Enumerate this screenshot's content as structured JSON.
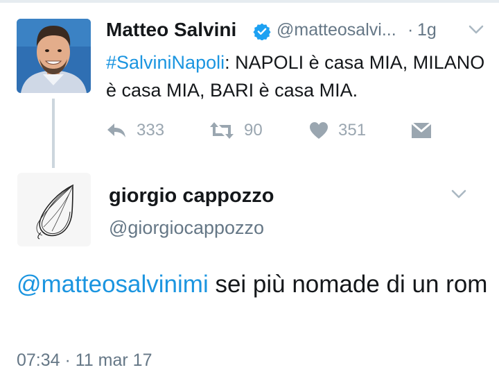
{
  "tweet": {
    "author_name": "Matteo Salvini",
    "author_handle": "@matteosalvi...",
    "separator": "·",
    "time": "1g",
    "hashtag": "#SalviniNapoli",
    "body": ": NAPOLI è casa MIA, MILANO è casa MIA, BARI è casa MIA.",
    "counts": {
      "replies": "333",
      "retweets": "90",
      "likes": "351"
    },
    "verified": true
  },
  "reply": {
    "author_name": "giorgio cappozzo",
    "author_handle": "@giorgiocappozzo",
    "mention": "@matteosalvinimi",
    "body": " sei più nomade di un rom",
    "timestamp": "07:34 · 11 mar 17"
  },
  "icons": {
    "verified": "verified-badge-icon",
    "caret": "chevron-down-icon",
    "reply": "reply-icon",
    "retweet": "retweet-icon",
    "like": "heart-icon",
    "dm": "envelope-icon"
  },
  "colors": {
    "link": "#1b95e0",
    "verified": "#1da1f2",
    "secondary_text": "#657786",
    "action_gray": "#9aa6b0",
    "thread_line": "#ccd6dd"
  }
}
